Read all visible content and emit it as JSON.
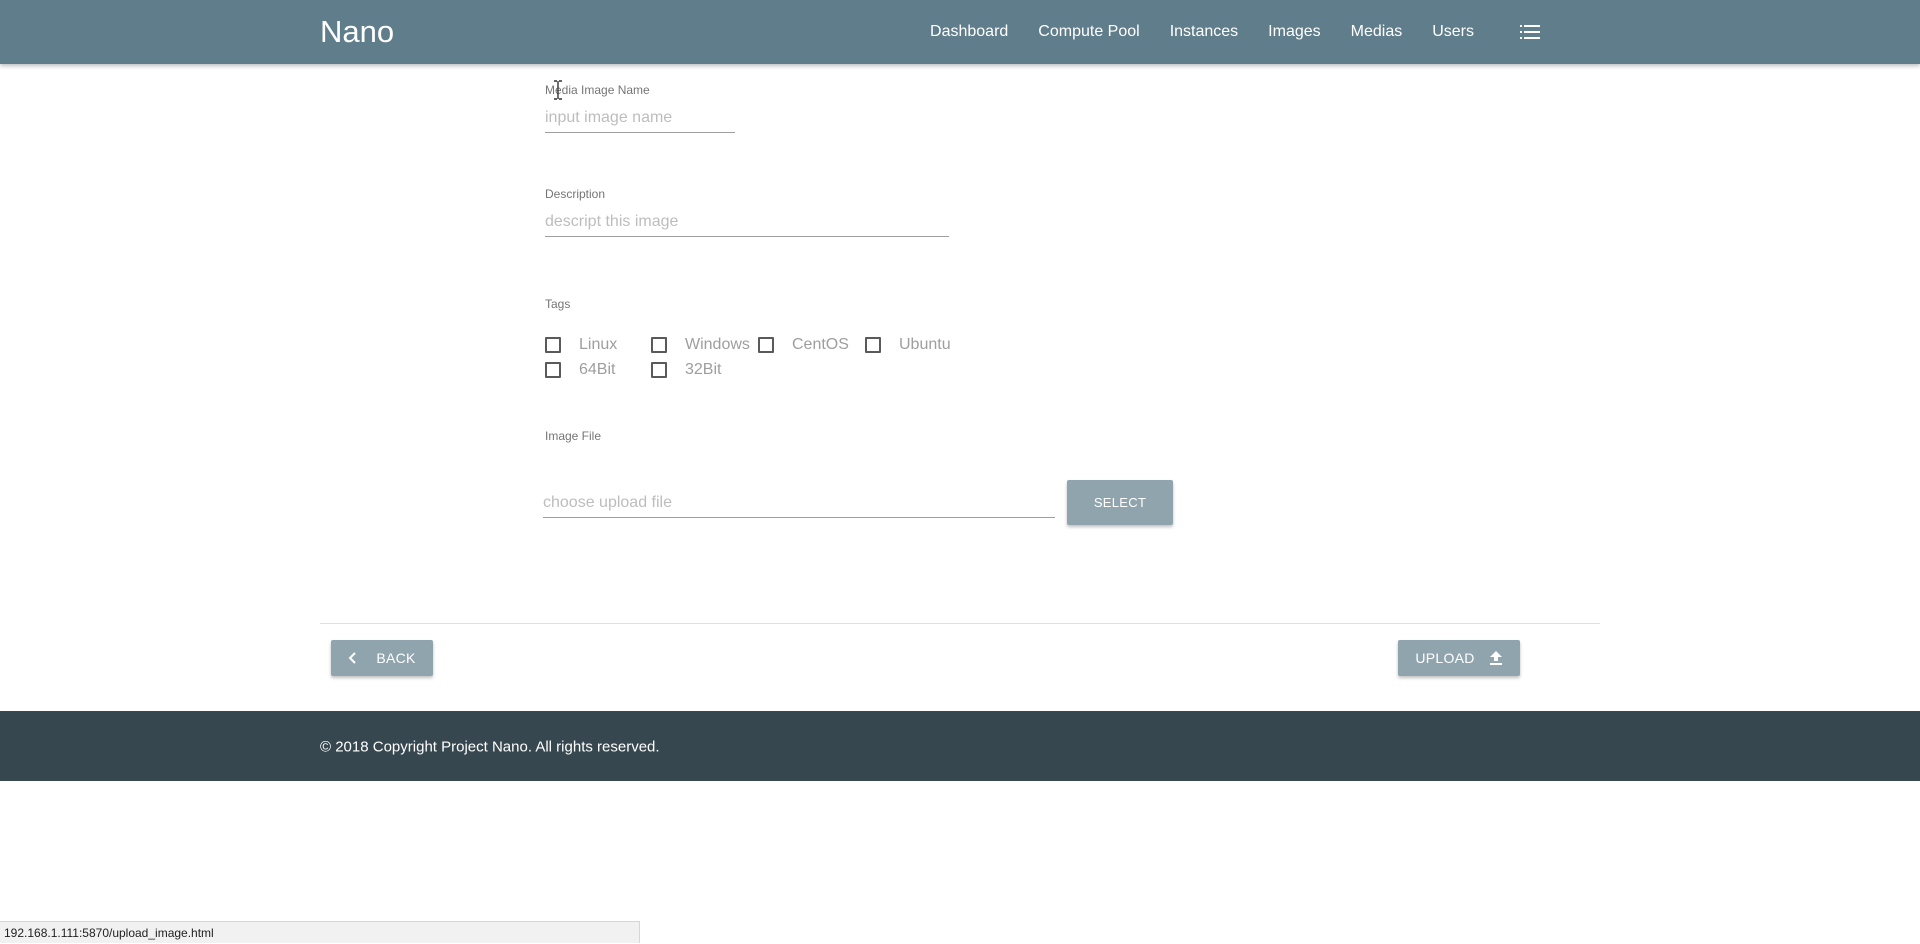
{
  "header": {
    "brand": "Nano",
    "nav": [
      "Dashboard",
      "Compute Pool",
      "Instances",
      "Images",
      "Medias",
      "Users"
    ],
    "menu_icon": "list-icon"
  },
  "form": {
    "name": {
      "label": "Media Image Name",
      "placeholder": "input image name",
      "value": ""
    },
    "description": {
      "label": "Description",
      "placeholder": "descript this image",
      "value": ""
    },
    "tags": {
      "label": "Tags",
      "options": [
        "Linux",
        "Windows",
        "CentOS",
        "Ubuntu",
        "64Bit",
        "32Bit"
      ]
    },
    "file": {
      "label": "Image File",
      "placeholder": "choose upload file",
      "select_label": "SELECT"
    }
  },
  "actions": {
    "back_label": "BACK",
    "upload_label": "UPLOAD"
  },
  "footer": {
    "text": "© 2018 Copyright Project Nano. All rights reserved."
  },
  "status": {
    "url": "192.168.1.111:5870/upload_image.html"
  },
  "colors": {
    "header": "#607d8b",
    "button": "#90a4ae",
    "footer": "#37474f"
  }
}
